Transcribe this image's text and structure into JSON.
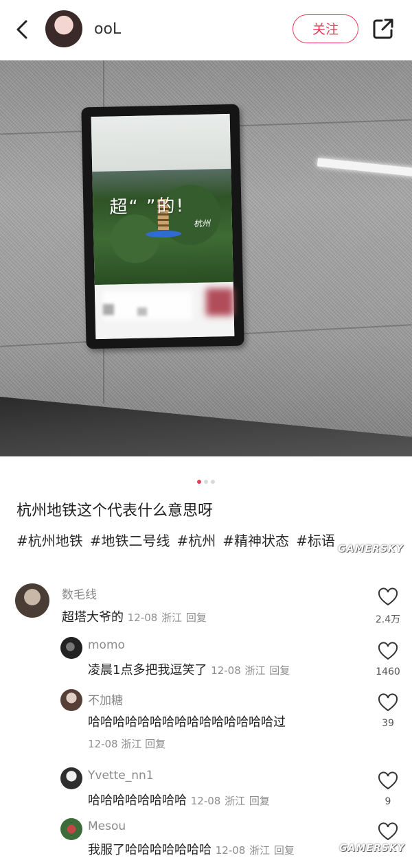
{
  "header": {
    "back_icon": "chevron-left-icon",
    "username": "ooL",
    "follow_label": "关注",
    "share_icon": "share-external-icon",
    "accent_color": "#e23e57"
  },
  "photo": {
    "poster_text": "超“ ”的!",
    "poster_logo": "杭州",
    "carousel": {
      "total": 3,
      "active": 1
    }
  },
  "post": {
    "title": "杭州地铁这个代表什么意思呀",
    "tags": [
      "#杭州地铁",
      "#地铁二号线",
      "#杭州",
      "#精神状态",
      "#标语"
    ]
  },
  "watermark": "GAMERSKY",
  "comments": [
    {
      "name": "数毛线",
      "text": "超塔大爷的",
      "date": "12-08",
      "region": "浙江",
      "reply": "回复",
      "likes": "2.4万"
    },
    {
      "name": "momo",
      "text": "凌晨1点多把我逗笑了",
      "date": "12-08",
      "region": "浙江",
      "reply": "回复",
      "likes": "1460"
    },
    {
      "name": "不加糖",
      "text": "哈哈哈哈哈哈哈哈哈哈哈哈哈哈哈过",
      "date": "12-08",
      "region": "浙江",
      "reply": "回复",
      "likes": "39"
    },
    {
      "name": "Yvette_nn1",
      "text": "哈哈哈哈哈哈哈哈",
      "date": "12-08",
      "region": "浙江",
      "reply": "回复",
      "likes": "9"
    },
    {
      "name": "Mesou",
      "text": "我服了哈哈哈哈哈哈哈",
      "date": "12-08",
      "region": "浙江",
      "reply": "回复",
      "likes": ""
    }
  ]
}
